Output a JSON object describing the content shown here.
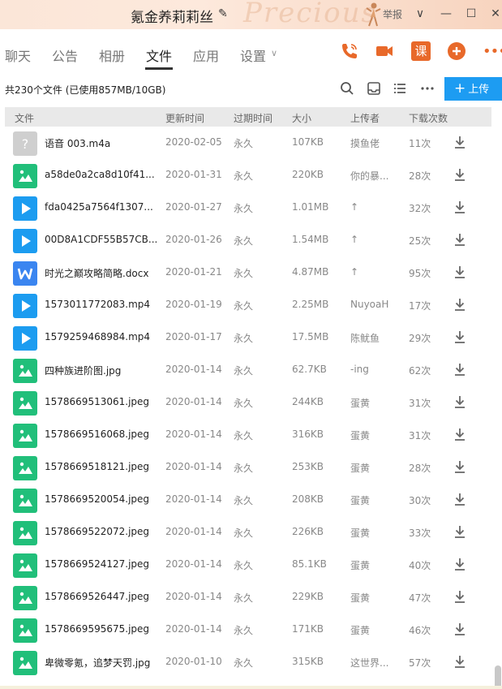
{
  "window": {
    "title": "氪金养莉莉丝",
    "report_label": "举报",
    "minimize_glyph": "—",
    "maximize_glyph": "☐",
    "close_glyph": "✕",
    "dropdown_glyph": "∨"
  },
  "nav": {
    "tabs": [
      {
        "label": "聊天"
      },
      {
        "label": "公告"
      },
      {
        "label": "相册"
      },
      {
        "label": "文件"
      },
      {
        "label": "应用"
      },
      {
        "label": "设置"
      }
    ],
    "active_tab": "文件",
    "settings_chevron": "∨",
    "actions": [
      "phone-icon",
      "video-call-icon",
      "course-icon",
      "add-chat-icon",
      "more-icon"
    ],
    "course_label": "课",
    "accent_color": "#e8692a"
  },
  "toolbar": {
    "summary": "共230个文件 (已使用857MB/10GB)",
    "upload_label": "上传",
    "upload_color": "#1d9cf2"
  },
  "table": {
    "headers": {
      "file": "文件",
      "updated": "更新时间",
      "expiry": "过期时间",
      "size": "大小",
      "uploader": "上传者",
      "downloads": "下载次数"
    },
    "rows": [
      {
        "type": "unknown",
        "name": "语音 003.m4a",
        "updated": "2020-02-05",
        "expiry": "永久",
        "size": "107KB",
        "uploader": "摸鱼佬",
        "downloads": "11次"
      },
      {
        "type": "image",
        "name": "a58de0a2ca8d10f41...",
        "updated": "2020-01-31",
        "expiry": "永久",
        "size": "220KB",
        "uploader": "你的暴...",
        "downloads": "28次"
      },
      {
        "type": "video",
        "name": "fda0425a7564f1307...",
        "updated": "2020-01-27",
        "expiry": "永久",
        "size": "1.01MB",
        "uploader": "↑",
        "downloads": "32次"
      },
      {
        "type": "video",
        "name": "00D8A1CDF55B57CB...",
        "updated": "2020-01-26",
        "expiry": "永久",
        "size": "1.54MB",
        "uploader": "↑",
        "downloads": "25次"
      },
      {
        "type": "doc",
        "name": "时光之巅攻略简略.docx",
        "updated": "2020-01-21",
        "expiry": "永久",
        "size": "4.87MB",
        "uploader": "↑",
        "downloads": "95次"
      },
      {
        "type": "video",
        "name": "1573011772083.mp4",
        "updated": "2020-01-19",
        "expiry": "永久",
        "size": "2.25MB",
        "uploader": "NuyoaH",
        "downloads": "17次"
      },
      {
        "type": "video",
        "name": "1579259468984.mp4",
        "updated": "2020-01-17",
        "expiry": "永久",
        "size": "17.5MB",
        "uploader": "陈鱿鱼",
        "downloads": "29次"
      },
      {
        "type": "image",
        "name": "四种族进阶图.jpg",
        "updated": "2020-01-14",
        "expiry": "永久",
        "size": "62.7KB",
        "uploader": "-ing",
        "downloads": "62次"
      },
      {
        "type": "image",
        "name": "1578669513061.jpeg",
        "updated": "2020-01-14",
        "expiry": "永久",
        "size": "244KB",
        "uploader": "蛋黄",
        "downloads": "31次"
      },
      {
        "type": "image",
        "name": "1578669516068.jpeg",
        "updated": "2020-01-14",
        "expiry": "永久",
        "size": "316KB",
        "uploader": "蛋黄",
        "downloads": "31次"
      },
      {
        "type": "image",
        "name": "1578669518121.jpeg",
        "updated": "2020-01-14",
        "expiry": "永久",
        "size": "253KB",
        "uploader": "蛋黄",
        "downloads": "28次"
      },
      {
        "type": "image",
        "name": "1578669520054.jpeg",
        "updated": "2020-01-14",
        "expiry": "永久",
        "size": "208KB",
        "uploader": "蛋黄",
        "downloads": "30次"
      },
      {
        "type": "image",
        "name": "1578669522072.jpeg",
        "updated": "2020-01-14",
        "expiry": "永久",
        "size": "226KB",
        "uploader": "蛋黄",
        "downloads": "33次"
      },
      {
        "type": "image",
        "name": "1578669524127.jpeg",
        "updated": "2020-01-14",
        "expiry": "永久",
        "size": "85.1KB",
        "uploader": "蛋黄",
        "downloads": "40次"
      },
      {
        "type": "image",
        "name": "1578669526447.jpeg",
        "updated": "2020-01-14",
        "expiry": "永久",
        "size": "229KB",
        "uploader": "蛋黄",
        "downloads": "47次"
      },
      {
        "type": "image",
        "name": "1578669595675.jpeg",
        "updated": "2020-01-14",
        "expiry": "永久",
        "size": "171KB",
        "uploader": "蛋黄",
        "downloads": "46次"
      },
      {
        "type": "image",
        "name": "卑微零氪，追梦天罚.jpg",
        "updated": "2020-01-10",
        "expiry": "永久",
        "size": "315KB",
        "uploader": "这世界...",
        "downloads": "57次"
      }
    ]
  },
  "colors": {
    "image": "#21bf7a",
    "video": "#1c9cf0",
    "doc": "#3a85f0",
    "unknown": "#cfcfcf"
  }
}
